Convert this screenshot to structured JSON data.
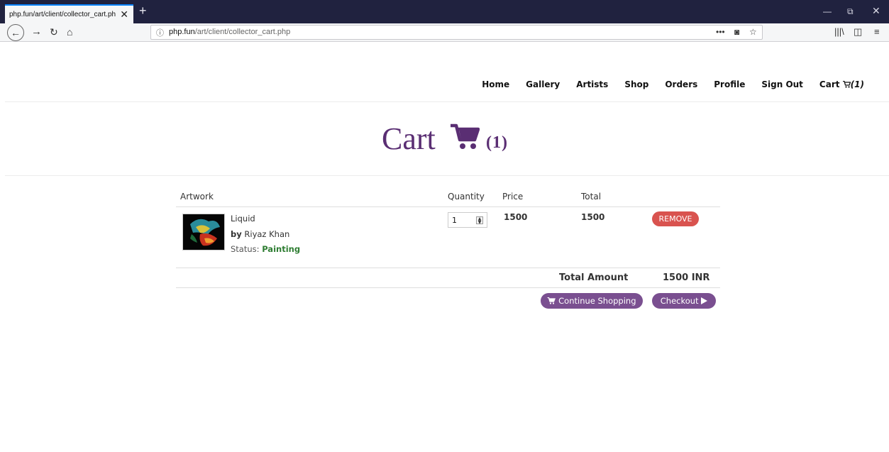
{
  "browser": {
    "tab_title": "php.fun/art/client/collector_cart.ph",
    "url_host": "php.fun",
    "url_path": "/art/client/collector_cart.php"
  },
  "nav": {
    "items": [
      "Home",
      "Gallery",
      "Artists",
      "Shop",
      "Orders",
      "Profile",
      "Sign Out"
    ],
    "cart_label": "Cart",
    "cart_count": "(1)"
  },
  "hero": {
    "title": "Cart",
    "count": "(1)"
  },
  "table": {
    "headers": {
      "artwork": "Artwork",
      "quantity": "Quantity",
      "price": "Price",
      "total": "Total"
    },
    "item": {
      "name": "Liquid",
      "by_label": "by",
      "artist": "Riyaz Khan",
      "status_label": "Status:",
      "status": "Painting",
      "quantity": "1",
      "price": "1500",
      "total": "1500",
      "remove_label": "REMOVE"
    },
    "total_amount_label": "Total Amount",
    "total_amount_value": "1500 INR"
  },
  "buttons": {
    "continue_shopping": "Continue Shopping",
    "checkout": "Checkout"
  },
  "colors": {
    "accent_purple": "#5a2e73",
    "button_purple": "#7a4f90",
    "remove_red": "#d9534f",
    "status_green": "#2e7d32"
  }
}
